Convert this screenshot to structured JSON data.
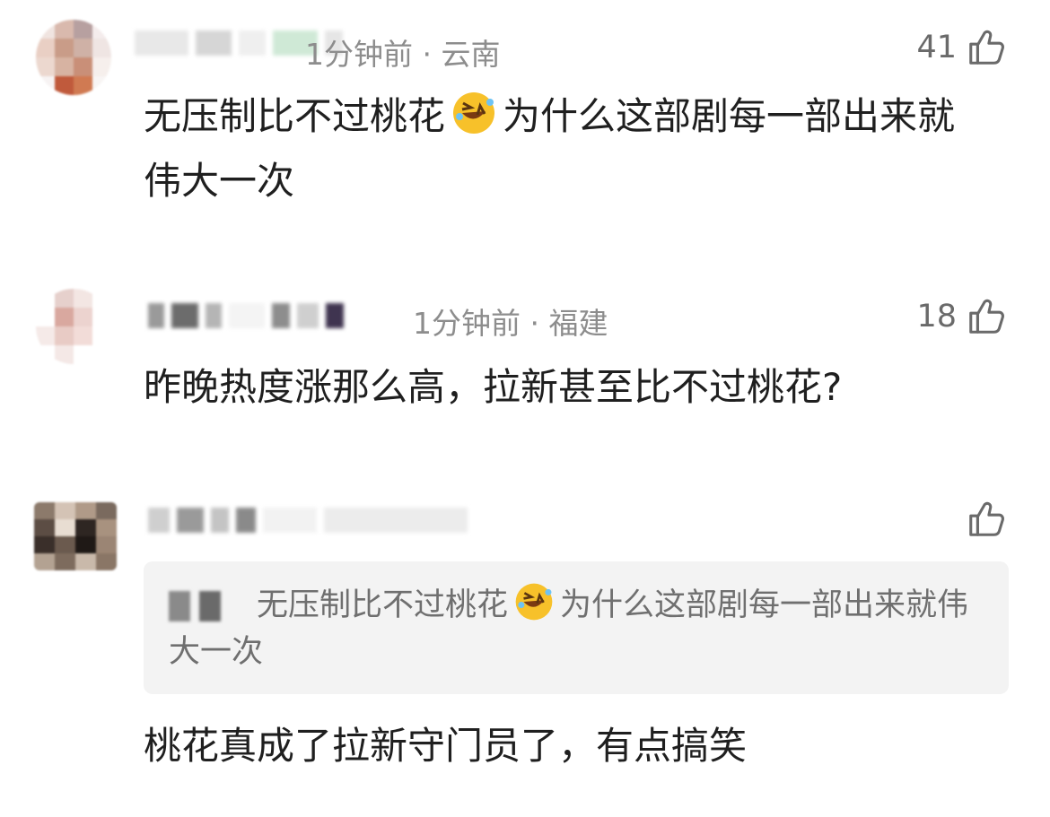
{
  "comments": [
    {
      "time_location": "1分钟前 · 云南",
      "like_count": "41",
      "text_part1": "无压制比不过桃花",
      "emoji": "rolling-on-floor-laughing",
      "text_part2": "为什么这部剧每一部出来就伟大一次"
    },
    {
      "time_location": "1分钟前 · 福建",
      "like_count": "18",
      "text": "昨晚热度涨那么高，拉新甚至比不过桃花?"
    },
    {
      "like_count": "",
      "quoted_text_part1": "无压制比不过桃花",
      "quoted_emoji": "rolling-on-floor-laughing",
      "quoted_text_part2": "为什么这部剧每一部出来就伟大一次",
      "text": "桃花真成了拉新守门员了，有点搞笑"
    }
  ],
  "colors": {
    "meta_text": "#8d8d8d",
    "body_text": "#1f1f1f",
    "quote_bg": "#f3f3f3"
  }
}
